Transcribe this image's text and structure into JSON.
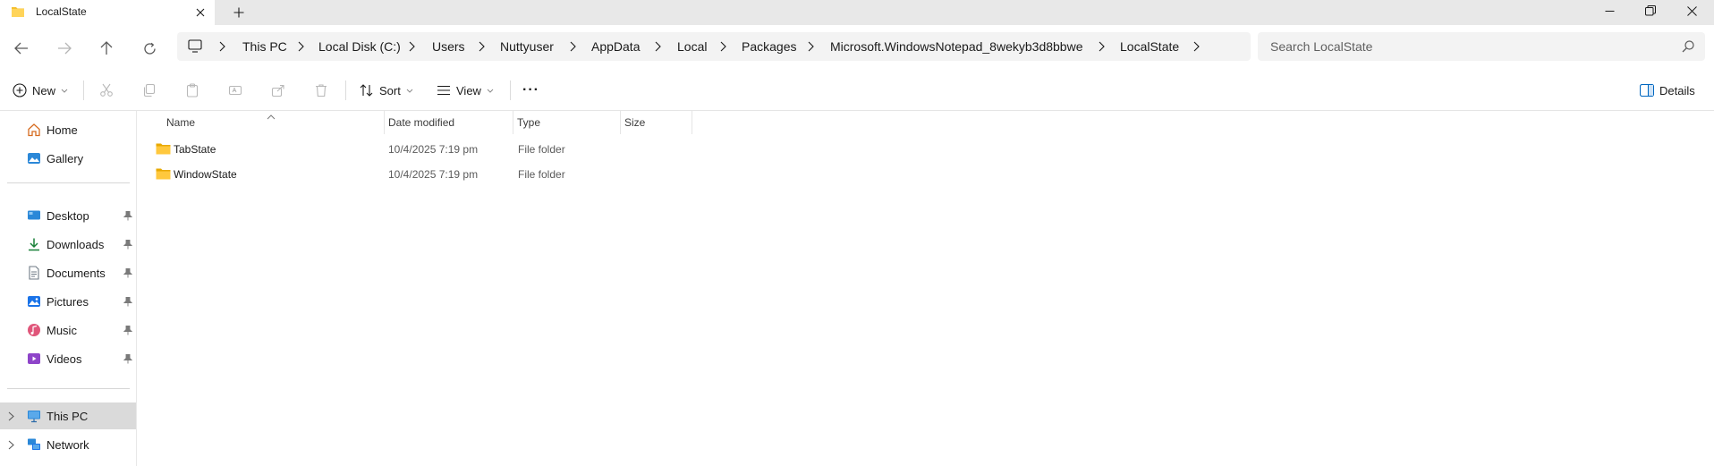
{
  "window": {
    "tab_title": "LocalState",
    "new_tab_symbol": "+"
  },
  "nav": {
    "breadcrumbs": [
      "This PC",
      "Local Disk (C:)",
      "Users",
      "Nuttyuser",
      "AppData",
      "Local",
      "Packages",
      "Microsoft.WindowsNotepad_8wekyb3d8bbwe",
      "LocalState"
    ],
    "search_placeholder": "Search LocalState"
  },
  "toolbar": {
    "new_label": "New",
    "sort_label": "Sort",
    "view_label": "View",
    "more_label": "···",
    "details_label": "Details"
  },
  "sidebar": {
    "top": [
      {
        "label": "Home",
        "icon": "home-icon"
      },
      {
        "label": "Gallery",
        "icon": "gallery-icon"
      }
    ],
    "quick_access": [
      {
        "label": "Desktop",
        "icon": "desktop-icon"
      },
      {
        "label": "Downloads",
        "icon": "downloads-icon"
      },
      {
        "label": "Documents",
        "icon": "documents-icon"
      },
      {
        "label": "Pictures",
        "icon": "pictures-icon"
      },
      {
        "label": "Music",
        "icon": "music-icon"
      },
      {
        "label": "Videos",
        "icon": "videos-icon"
      }
    ],
    "bottom": [
      {
        "label": "This PC",
        "icon": "this-pc-icon",
        "selected": true
      },
      {
        "label": "Network",
        "icon": "network-icon",
        "selected": false
      }
    ]
  },
  "files": {
    "columns": [
      "Name",
      "Date modified",
      "Type",
      "Size"
    ],
    "rows": [
      {
        "name": "TabState",
        "date": "10/4/2025 7:19 pm",
        "type": "File folder",
        "size": ""
      },
      {
        "name": "WindowState",
        "date": "10/4/2025 7:19 pm",
        "type": "File folder",
        "size": ""
      }
    ]
  },
  "colors": {
    "accent": "#0067c0",
    "folder": "#f5c02e",
    "selected_bg": "#dadada"
  }
}
